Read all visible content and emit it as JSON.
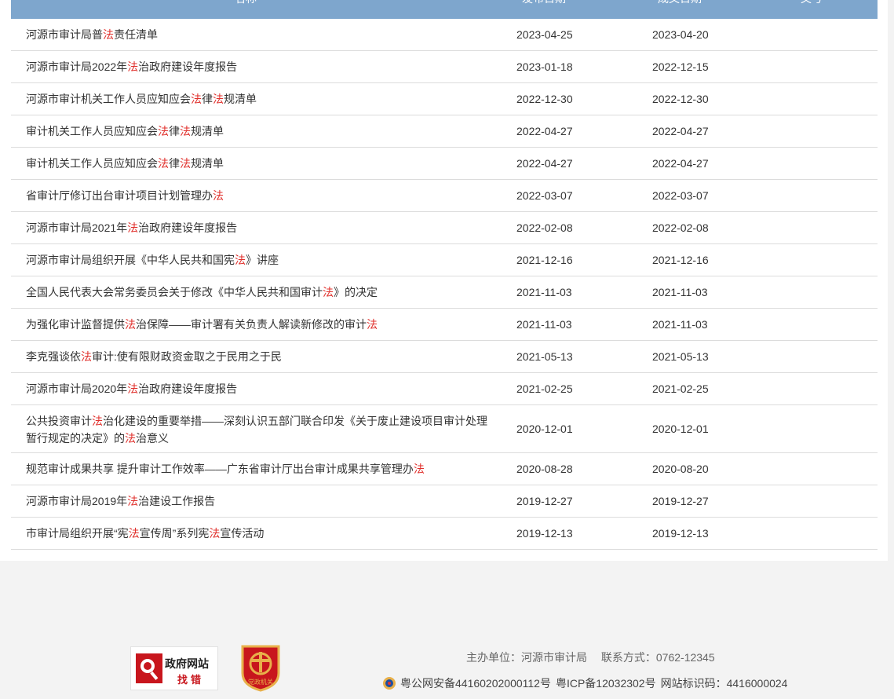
{
  "table": {
    "headers": [
      "名称",
      "发布日期",
      "成文日期",
      "文号"
    ],
    "rows": [
      {
        "title": [
          [
            "河源市审计局普",
            0
          ],
          [
            "法",
            1
          ],
          [
            "责任清单",
            0
          ]
        ],
        "publish": "2023-04-25",
        "written": "2023-04-20"
      },
      {
        "title": [
          [
            "河源市审计局2022年",
            0
          ],
          [
            "法",
            1
          ],
          [
            "治政府建设年度报告",
            0
          ]
        ],
        "publish": "2023-01-18",
        "written": "2022-12-15"
      },
      {
        "title": [
          [
            "河源市审计机关工作人员应知应会",
            0
          ],
          [
            "法",
            1
          ],
          [
            "律",
            0
          ],
          [
            "法",
            1
          ],
          [
            "规清单",
            0
          ]
        ],
        "publish": "2022-12-30",
        "written": "2022-12-30"
      },
      {
        "title": [
          [
            "审计机关工作人员应知应会",
            0
          ],
          [
            "法",
            1
          ],
          [
            "律",
            0
          ],
          [
            "法",
            1
          ],
          [
            "规清单",
            0
          ]
        ],
        "publish": "2022-04-27",
        "written": "2022-04-27"
      },
      {
        "title": [
          [
            "审计机关工作人员应知应会",
            0
          ],
          [
            "法",
            1
          ],
          [
            "律",
            0
          ],
          [
            "法",
            1
          ],
          [
            "规清单",
            0
          ]
        ],
        "publish": "2022-04-27",
        "written": "2022-04-27"
      },
      {
        "title": [
          [
            "省审计厅修订出台审计项目计划管理办",
            0
          ],
          [
            "法",
            1
          ]
        ],
        "publish": "2022-03-07",
        "written": "2022-03-07"
      },
      {
        "title": [
          [
            "河源市审计局2021年",
            0
          ],
          [
            "法",
            1
          ],
          [
            "治政府建设年度报告",
            0
          ]
        ],
        "publish": "2022-02-08",
        "written": "2022-02-08"
      },
      {
        "title": [
          [
            "河源市审计局组织开展《中华人民共和国宪",
            0
          ],
          [
            "法",
            1
          ],
          [
            "》讲座",
            0
          ]
        ],
        "publish": "2021-12-16",
        "written": "2021-12-16"
      },
      {
        "title": [
          [
            "全国人民代表大会常务委员会关于修改《中华人民共和国审计",
            0
          ],
          [
            "法",
            1
          ],
          [
            "》的决定",
            0
          ]
        ],
        "publish": "2021-11-03",
        "written": "2021-11-03"
      },
      {
        "title": [
          [
            "为强化审计监督提供",
            0
          ],
          [
            "法",
            1
          ],
          [
            "治保障——审计署有关负责人解读新修改的审计",
            0
          ],
          [
            "法",
            1
          ]
        ],
        "publish": "2021-11-03",
        "written": "2021-11-03"
      },
      {
        "title": [
          [
            "李克强谈依",
            0
          ],
          [
            "法",
            1
          ],
          [
            "审计:使有限财政资金取之于民用之于民",
            0
          ]
        ],
        "publish": "2021-05-13",
        "written": "2021-05-13"
      },
      {
        "title": [
          [
            "河源市审计局2020年",
            0
          ],
          [
            "法",
            1
          ],
          [
            "治政府建设年度报告",
            0
          ]
        ],
        "publish": "2021-02-25",
        "written": "2021-02-25"
      },
      {
        "title": [
          [
            "公共投资审计",
            0
          ],
          [
            "法",
            1
          ],
          [
            "治化建设的重要举措——深刻认识五部门联合印发《关于废止建设项目审计处理暂行规定的决定》的",
            0
          ],
          [
            "法",
            1
          ],
          [
            "治意义",
            0
          ]
        ],
        "publish": "2020-12-01",
        "written": "2020-12-01",
        "tall": true
      },
      {
        "title": [
          [
            "规范审计成果共享 提升审计工作效率——广东省审计厅出台审计成果共享管理办",
            0
          ],
          [
            "法",
            1
          ]
        ],
        "publish": "2020-08-28",
        "written": "2020-08-20"
      },
      {
        "title": [
          [
            "河源市审计局2019年",
            0
          ],
          [
            "法",
            1
          ],
          [
            "治建设工作报告",
            0
          ]
        ],
        "publish": "2019-12-27",
        "written": "2019-12-27"
      },
      {
        "title": [
          [
            "市审计局组织开展“宪",
            0
          ],
          [
            "法",
            1
          ],
          [
            "宣传周”系列宪",
            0
          ],
          [
            "法",
            1
          ],
          [
            "宣传活动",
            0
          ]
        ],
        "publish": "2019-12-13",
        "written": "2019-12-13"
      }
    ]
  },
  "footer": {
    "badge_find_line1": "政府网站",
    "badge_find_line2": "找错",
    "badge_party_text": "党政机关",
    "sponsor": "主办单位：河源市审计局",
    "contact": "联系方式：0762-12345",
    "police_record": "粤公网安备44160202000112号",
    "icp": "粤ICP备12032302号",
    "site_code": "网站标识码：4416000024"
  },
  "colors": {
    "header_bg": "#7ea6cd",
    "highlight": "#e0302c",
    "footer_bg": "#f3f3f3"
  }
}
